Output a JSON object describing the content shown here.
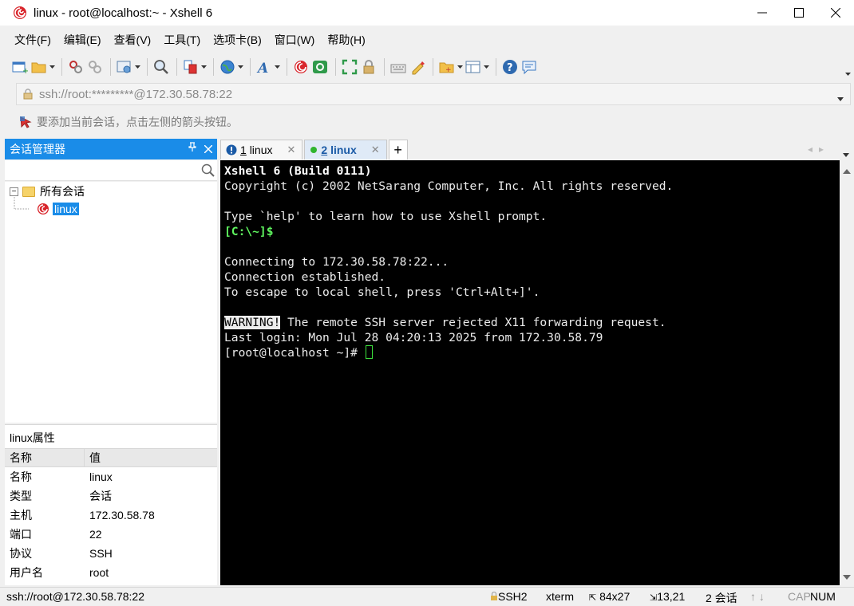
{
  "window": {
    "title": "linux - root@localhost:~ - Xshell 6"
  },
  "menu": {
    "items": [
      "文件(F)",
      "编辑(E)",
      "查看(V)",
      "工具(T)",
      "选项卡(B)",
      "窗口(W)",
      "帮助(H)"
    ]
  },
  "toolbar": {
    "icons": [
      "new-session-icon",
      "open-folder-icon",
      "disconnect-icon",
      "reconnect-icon",
      "properties-icon",
      "find-icon",
      "copy-paste-icon",
      "globe-icon",
      "font-icon",
      "xshell-logo-icon",
      "xftp-icon",
      "fullscreen-icon",
      "lock-icon",
      "keyboard-icon",
      "highlight-icon",
      "new-folder-icon",
      "layout-icon",
      "help-icon",
      "chat-icon"
    ]
  },
  "address": {
    "value": "ssh://root:*********@172.30.58.78:22"
  },
  "hint": {
    "text": "要添加当前会话，点击左侧的箭头按钮。"
  },
  "session_manager": {
    "title": "会话管理器",
    "search_placeholder": "",
    "tree": {
      "root_label": "所有会话",
      "items": [
        {
          "label": "linux",
          "selected": true
        }
      ]
    }
  },
  "properties": {
    "title": "linux属性",
    "col_name": "名称",
    "col_value": "值",
    "rows": [
      {
        "name": "名称",
        "value": "linux"
      },
      {
        "name": "类型",
        "value": "会话"
      },
      {
        "name": "主机",
        "value": "172.30.58.78"
      },
      {
        "name": "端口",
        "value": "22"
      },
      {
        "name": "协议",
        "value": "SSH"
      },
      {
        "name": "用户名",
        "value": "root"
      }
    ]
  },
  "tabs": [
    {
      "num": "1",
      "label": "linux",
      "active": false,
      "status": "warning"
    },
    {
      "num": "2",
      "label": "linux",
      "active": true,
      "status": "connected"
    }
  ],
  "terminal": {
    "line1": "Xshell 6 (Build 0111)",
    "line2": "Copyright (c) 2002 NetSarang Computer, Inc. All rights reserved.",
    "line3": "Type `help' to learn how to use Xshell prompt.",
    "prompt_local": "[C:\\~]$",
    "line5": "Connecting to 172.30.58.78:22...",
    "line6": "Connection established.",
    "line7": "To escape to local shell, press 'Ctrl+Alt+]'.",
    "warning_tag": "WARNING!",
    "warning_text": " The remote SSH server rejected X11 forwarding request.",
    "last_login": "Last login: Mon Jul 28 04:20:13 2025 from 172.30.58.79",
    "prompt_remote": "[root@localhost ~]# "
  },
  "status": {
    "connection": "ssh://root@172.30.58.78:22",
    "protocol": "SSH2",
    "terminal_type": "xterm",
    "size": "84x27",
    "cursor_pos": "13,21",
    "sessions": "2 会话",
    "cap": "CAP",
    "num": "NUM"
  },
  "colors": {
    "accent": "#1a8ce8",
    "terminal_bg": "#000000",
    "prompt_green": "#5ff55f"
  }
}
